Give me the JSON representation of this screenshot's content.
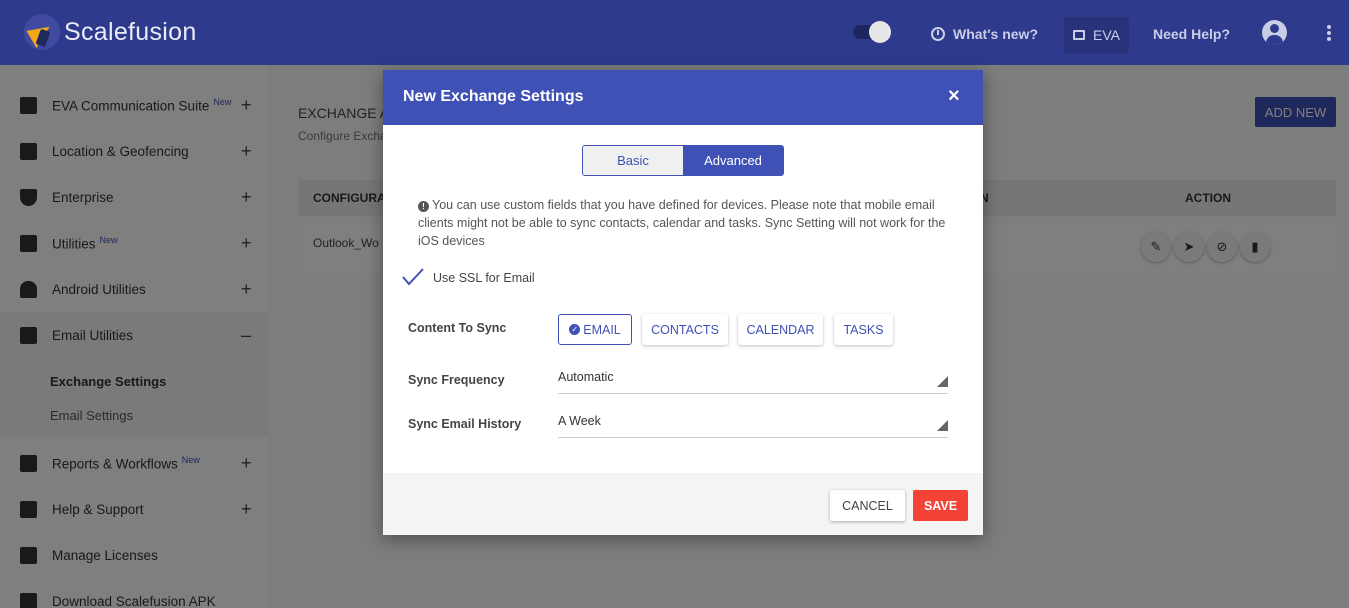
{
  "app": {
    "brand": "Scalefusion"
  },
  "topbar": {
    "whats_new": "What's new?",
    "eva": "EVA",
    "need_help": "Need Help?"
  },
  "sidebar": {
    "items": [
      {
        "label": "EVA Communication Suite",
        "badge": "New",
        "expand": "+"
      },
      {
        "label": "Location & Geofencing",
        "expand": "+"
      },
      {
        "label": "Enterprise",
        "expand": "+"
      },
      {
        "label": "Utilities",
        "badge": "New",
        "expand": "+"
      },
      {
        "label": "Android Utilities",
        "expand": "+"
      },
      {
        "label": "Email Utilities",
        "expand": "–"
      },
      {
        "label": "Reports & Workflows",
        "badge": "New",
        "expand": "+"
      },
      {
        "label": "Help & Support",
        "expand": "+"
      },
      {
        "label": "Manage Licenses"
      },
      {
        "label": "Download Scalefusion APK"
      }
    ],
    "subitems": [
      "Exchange Settings",
      "Email Settings"
    ]
  },
  "main": {
    "title": "EXCHANGE A",
    "subtitle": "Configure Excha",
    "add_new": "ADD NEW",
    "table": {
      "headers": [
        "CONFIGURAT",
        "N",
        "ACTION"
      ],
      "rows": [
        [
          "Outlook_Wo"
        ]
      ]
    }
  },
  "modal": {
    "title": "New Exchange Settings",
    "close": "×",
    "tabs": {
      "basic": "Basic",
      "advanced": "Advanced"
    },
    "note": "You can use custom fields that you have defined for devices. Please note that mobile email clients might not be able to sync contacts, calendar and tasks. Sync Setting will not work for the iOS devices",
    "ssl_label": "Use SSL for Email",
    "content_label": "Content To Sync",
    "chips": [
      "EMAIL",
      "CONTACTS",
      "CALENDAR",
      "TASKS"
    ],
    "freq_label": "Sync Frequency",
    "freq_value": "Automatic",
    "history_label": "Sync Email History",
    "history_value": "A Week",
    "cancel": "CANCEL",
    "save": "SAVE"
  },
  "colors": {
    "primary": "#3f51b5",
    "topbar": "#2e3a8c",
    "danger": "#f44336"
  }
}
